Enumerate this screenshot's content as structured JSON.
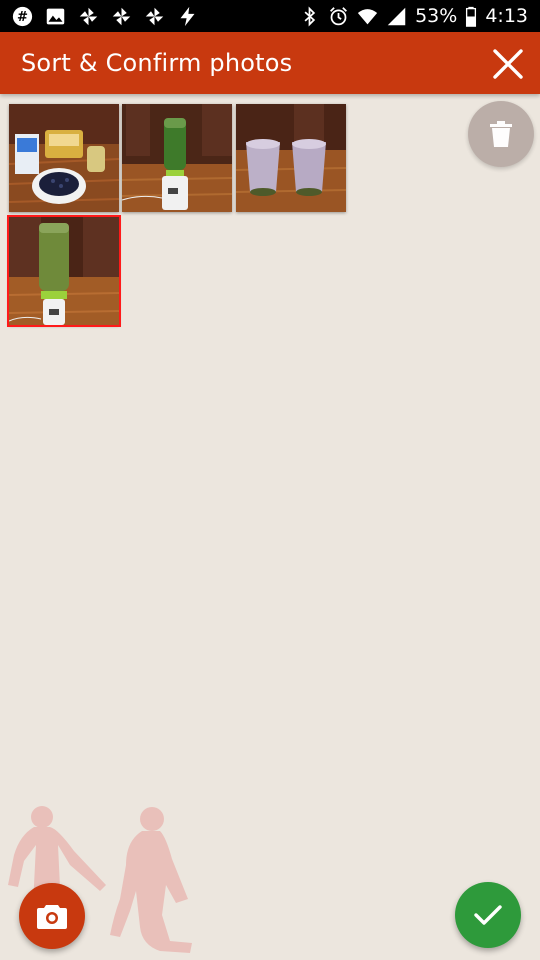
{
  "status_bar": {
    "left_icons": [
      "slack-icon",
      "image-icon",
      "pinwheel-icon",
      "pinwheel-icon",
      "pinwheel-icon",
      "flash-icon"
    ],
    "right_icons": [
      "bluetooth-icon",
      "alarm-icon",
      "wifi-icon",
      "signal-icon",
      "battery-icon"
    ],
    "battery": "53%",
    "time": "4:13"
  },
  "app_bar": {
    "title": "Sort & Confirm photos",
    "background": "#c8390f",
    "close_icon": "close-icon"
  },
  "photos": [
    {
      "name": "photo-ingredients",
      "selected": false
    },
    {
      "name": "photo-green-smoothie-blender",
      "selected": false
    },
    {
      "name": "photo-purple-smoothies",
      "selected": false
    },
    {
      "name": "photo-green-smoothie-closeup",
      "selected": true
    }
  ],
  "actions": {
    "delete_icon": "trash-icon",
    "camera_icon": "camera-icon",
    "confirm_icon": "check-icon"
  },
  "colors": {
    "accent": "#c8390f",
    "confirm": "#2e9a3b",
    "background": "#ece6de",
    "selected_outline": "#ff1a1a"
  }
}
